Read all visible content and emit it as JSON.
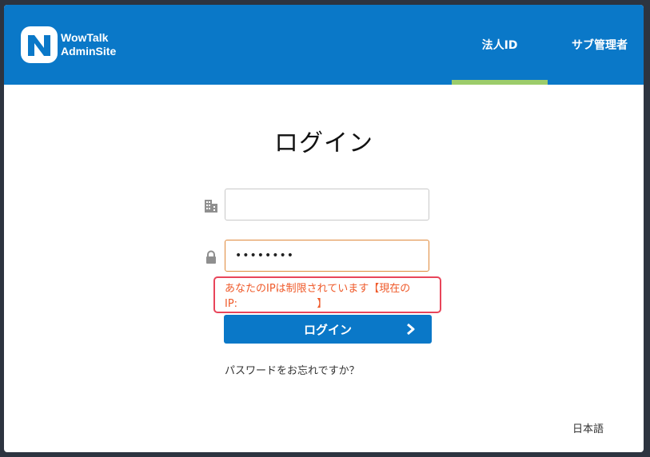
{
  "header": {
    "brand_line1": "WowTalk",
    "brand_line2": "AdminSite",
    "tabs": [
      {
        "label": "法人ID",
        "active": true
      },
      {
        "label": "サブ管理者",
        "active": false
      }
    ],
    "colors": {
      "background": "#0a78c8",
      "active_indicator": "#9ccc6a"
    }
  },
  "main": {
    "title": "ログイン",
    "company_field": {
      "value": "",
      "icon": "building-icon"
    },
    "password_field": {
      "value": "••••••••",
      "icon": "lock-icon"
    },
    "error": {
      "line1": "あなたのIPは制限されています【現在の",
      "line2": "IP:                        】"
    },
    "login_button": {
      "label": "ログイン",
      "icon": "chevron-right-icon"
    },
    "forgot_link": "パスワードをお忘れですか？"
  },
  "footer": {
    "language": "日本語"
  }
}
